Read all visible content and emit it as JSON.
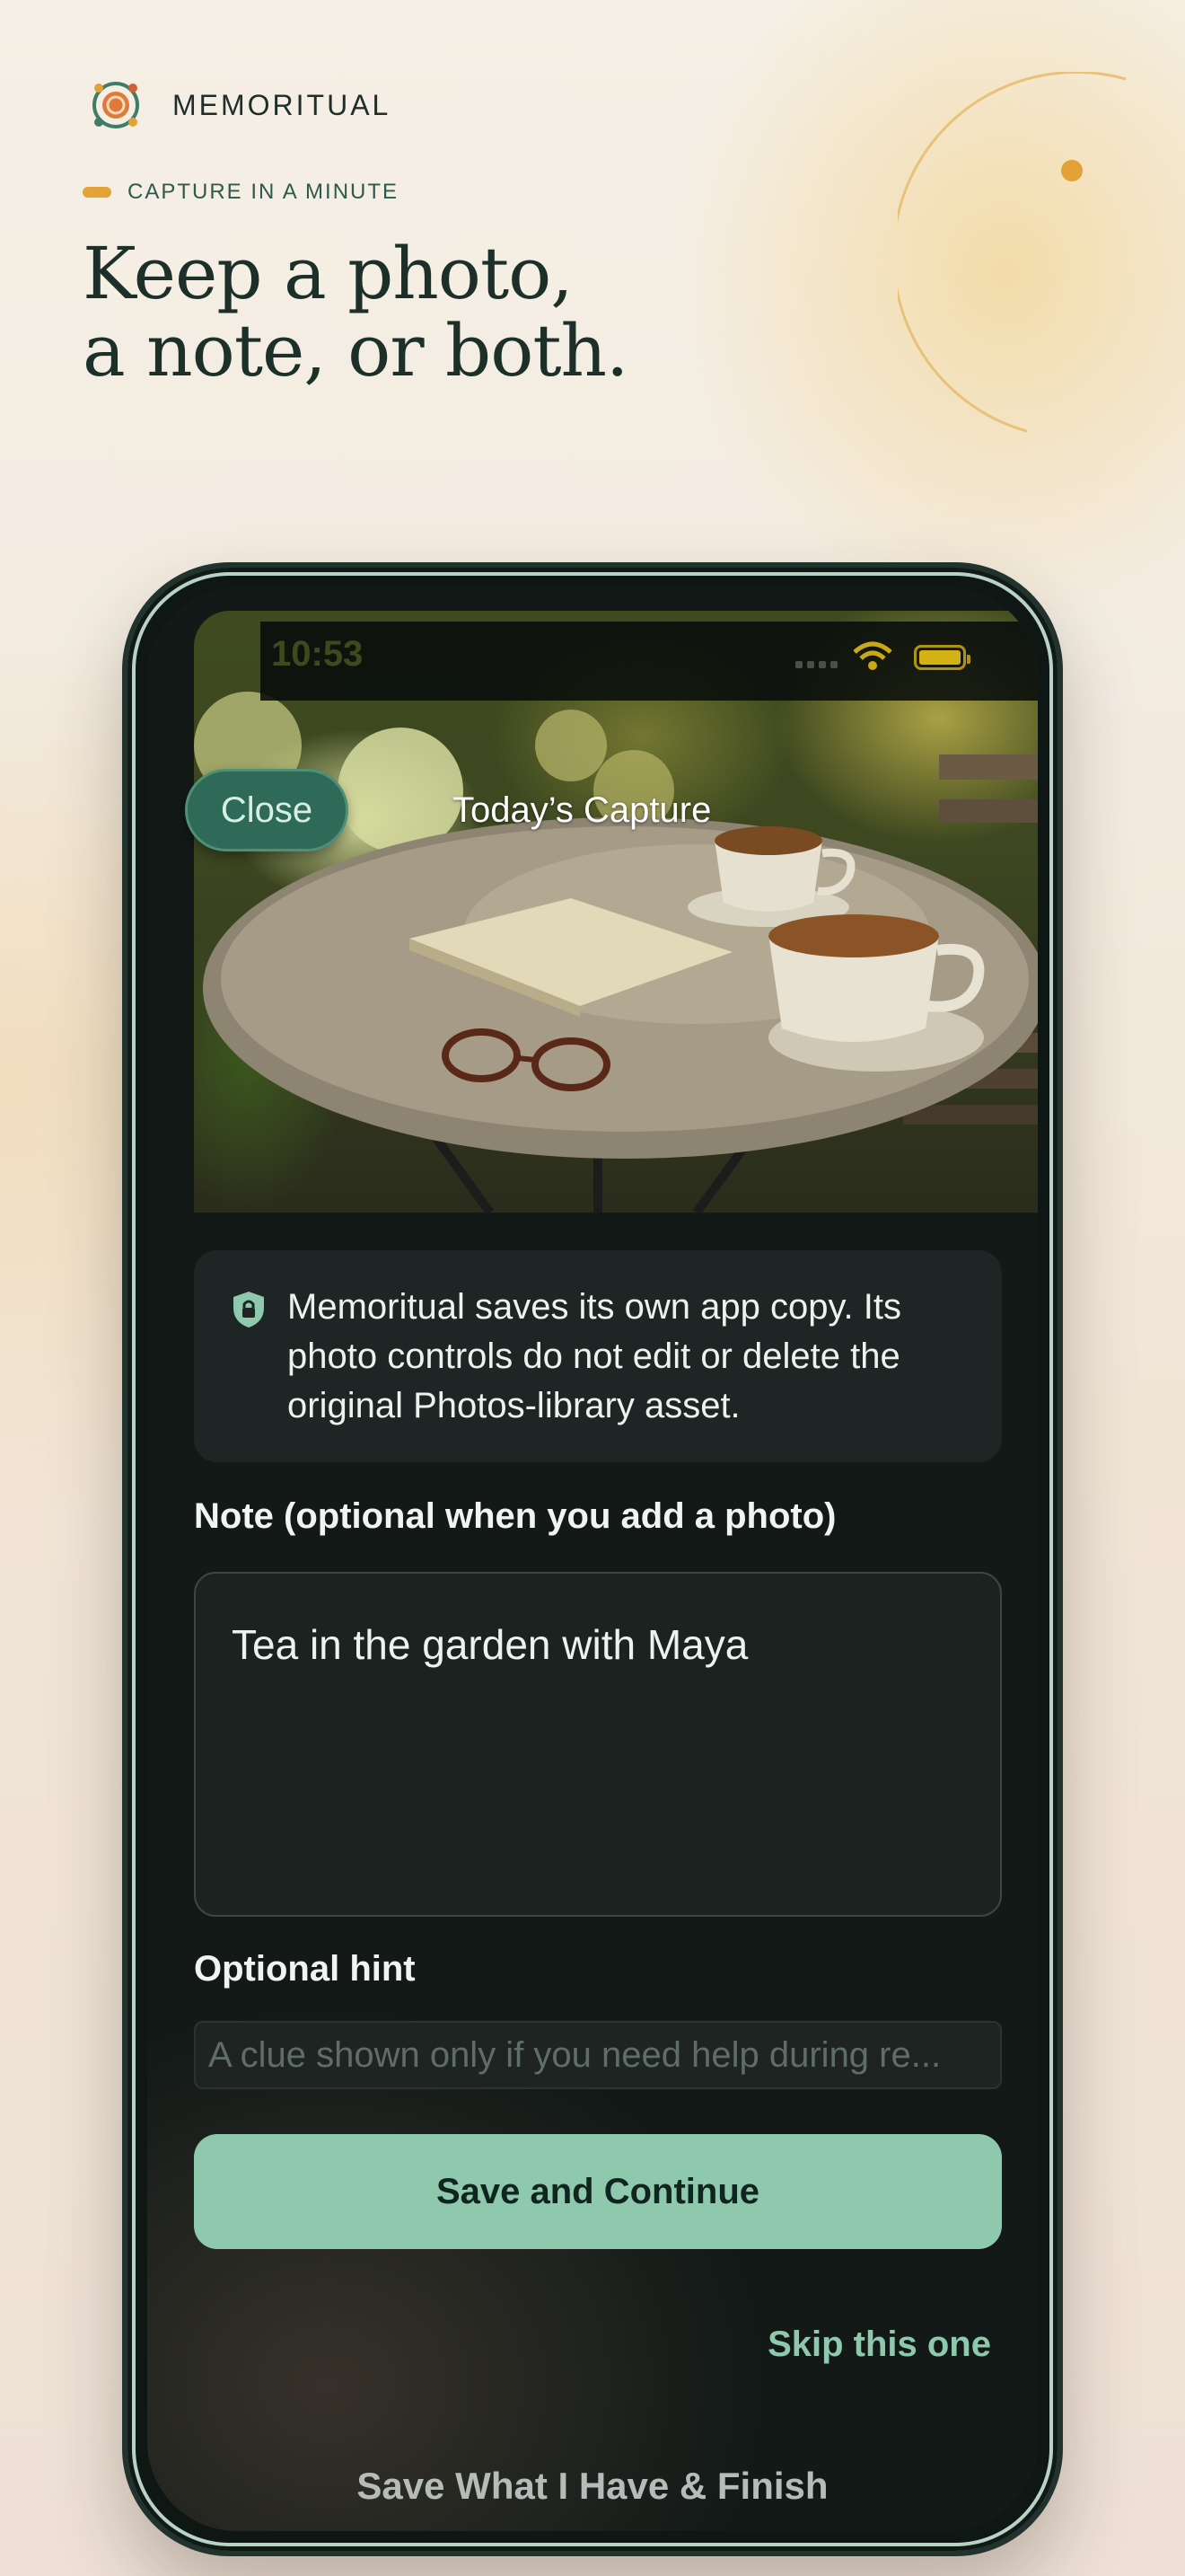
{
  "brand": {
    "name": "MEMORITUAL",
    "logo_icon": "memoritual-logo-icon"
  },
  "hero": {
    "eyebrow": "CAPTURE IN A MINUTE",
    "headline_line1": "Keep a photo,",
    "headline_line2": "a note, or both."
  },
  "colors": {
    "accent_orange": "#e3a235",
    "brand_green": "#2d5a4b",
    "button_mint": "#8fc9ad",
    "screen_dark": "#121917"
  },
  "status_bar": {
    "time": "10:53",
    "icons": [
      "signal-icon",
      "wifi-icon",
      "battery-icon"
    ]
  },
  "capture": {
    "close_label": "Close",
    "title": "Today’s Capture",
    "notice": "Memoritual saves its own app copy. Its photo controls do not edit or delete the original Photos-library asset.",
    "notice_icon": "shield-icon",
    "note_label": "Note (optional when you add a photo)",
    "note_value": "Tea in the garden with Maya",
    "hint_label": "Optional hint",
    "hint_placeholder": "A clue shown only if you need help during re...",
    "save_label": "Save and Continue",
    "skip_label": "Skip this one",
    "finish_label": "Save What I Have & Finish"
  }
}
